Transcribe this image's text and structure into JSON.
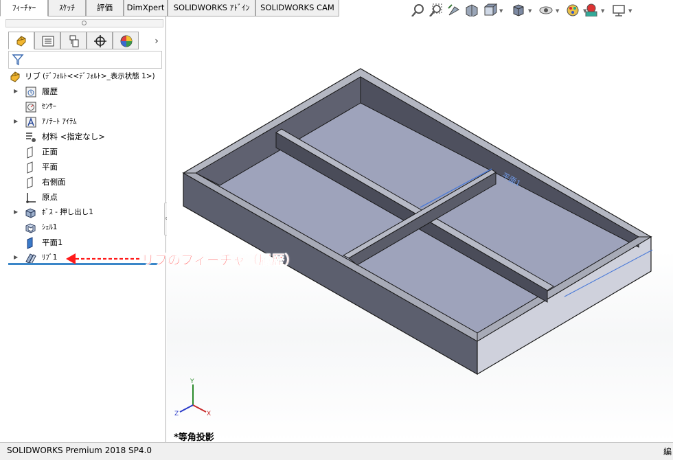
{
  "tabs": [
    {
      "label": "ﾌｨｰﾁｬｰ",
      "active": true
    },
    {
      "label": "ｽｹｯﾁ"
    },
    {
      "label": "評価"
    },
    {
      "label": "DimXpert"
    },
    {
      "label": "SOLIDWORKS ｱﾄﾞｲﾝ"
    },
    {
      "label": "SOLIDWORKS CAM"
    }
  ],
  "heads_up_toolbar": [
    "zoom-to-fit-icon",
    "zoom-to-area-icon",
    "previous-view-icon",
    "section-view-icon",
    "view-orientation-icon",
    "display-style-icon",
    "hide-show-items-icon",
    "edit-appearance-icon",
    "apply-scene-icon",
    "view-settings-icon"
  ],
  "manager_tabs": [
    "featuremanager-icon",
    "propertymanager-icon",
    "configurationmanager-icon",
    "dimxpertmanager-icon",
    "displaymanager-icon"
  ],
  "feature_tree": {
    "root": {
      "name": "リブ",
      "config": "(ﾃﾞﾌｫﾙﾄ<<ﾃﾞﾌｫﾙﾄ>_表示状態 1>)"
    },
    "items": [
      {
        "label": "履歴",
        "icon": "history-icon",
        "expandable": true
      },
      {
        "label": "ｾﾝｻｰ",
        "icon": "sensors-icon",
        "expandable": false
      },
      {
        "label": "ｱﾉﾃｰﾄ ｱｲﾃﾑ",
        "icon": "annotations-icon",
        "expandable": true
      },
      {
        "label": "材料 <指定なし>",
        "icon": "material-icon",
        "expandable": false
      },
      {
        "label": "正面",
        "icon": "plane-icon",
        "expandable": false
      },
      {
        "label": "平面",
        "icon": "plane-icon",
        "expandable": false
      },
      {
        "label": "右側面",
        "icon": "plane-icon",
        "expandable": false
      },
      {
        "label": "原点",
        "icon": "origin-icon",
        "expandable": false
      },
      {
        "label": "ﾎﾞｽ - 押し出し1",
        "icon": "boss-extrude-icon",
        "expandable": true
      },
      {
        "label": "ｼｪﾙ1",
        "icon": "shell-icon",
        "expandable": false
      },
      {
        "label": "平面1",
        "icon": "plane-icon",
        "expandable": false
      },
      {
        "label": "ﾘﾌﾞ1",
        "icon": "rib-icon",
        "expandable": true
      }
    ]
  },
  "annotation": {
    "text": "リブのフィーチャ（履歴）",
    "color": "#ff1a1a"
  },
  "model": {
    "plane_label": "平面1"
  },
  "triad": {
    "x": "X",
    "y": "Y",
    "z": "Z"
  },
  "view_label": "*等角投影",
  "status": {
    "left": "SOLIDWORKS Premium 2018 SP4.0",
    "right": "編"
  }
}
